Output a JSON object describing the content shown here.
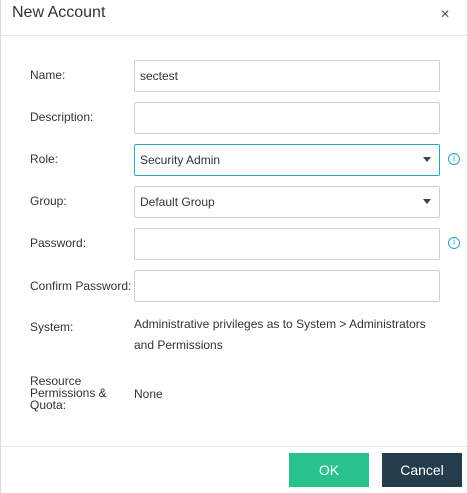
{
  "dialog": {
    "title": "New Account",
    "close_glyph": "×"
  },
  "form": {
    "name": {
      "label": "Name:",
      "value": "sectest"
    },
    "description": {
      "label": "Description:",
      "value": ""
    },
    "role": {
      "label": "Role:",
      "selected": "Security Admin",
      "info_icon": "info-icon"
    },
    "group": {
      "label": "Group:",
      "selected": "Default Group"
    },
    "password": {
      "label": "Password:",
      "value": "",
      "info_icon": "info-icon"
    },
    "confirm_password": {
      "label": "Confirm Password:",
      "value": ""
    },
    "system": {
      "label": "System:",
      "value_line1": "Administrative privileges as to System > Administrators",
      "value_line2": "and Permissions"
    },
    "resource": {
      "label_line1": "Resource",
      "label_line2": "Permissions &",
      "label_line3": "Quota:",
      "value": "None"
    }
  },
  "buttons": {
    "ok": "OK",
    "cancel": "Cancel"
  },
  "colors": {
    "accent": "#2aa7c9",
    "ok": "#29c18c",
    "cancel": "#233d4d"
  }
}
